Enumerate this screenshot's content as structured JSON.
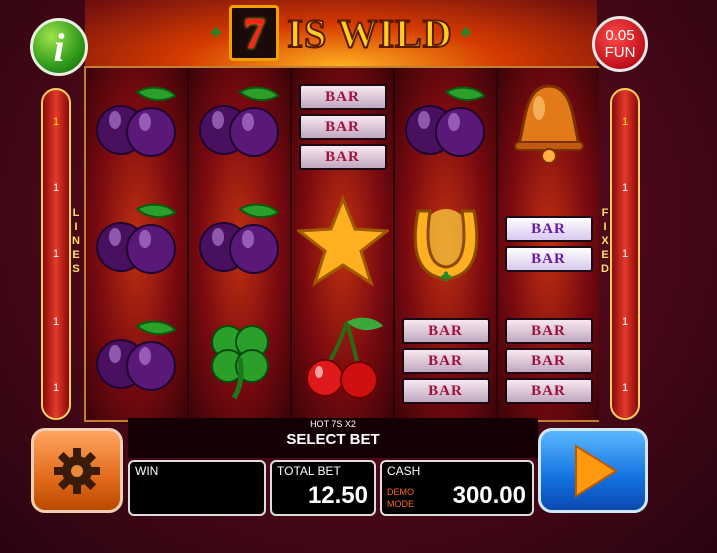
{
  "banner": {
    "seven": "7",
    "title": "IS WILD"
  },
  "info_button": {
    "label": "i"
  },
  "coin_button": {
    "value": "0.05",
    "currency": "FUN"
  },
  "left_rail": {
    "label": "LINES",
    "numbers": [
      "1",
      "1",
      "1",
      "1",
      "1"
    ]
  },
  "right_rail": {
    "label": "FIXED",
    "numbers": [
      "1",
      "1",
      "1",
      "1",
      "1"
    ]
  },
  "reels": [
    [
      "plum",
      "plum",
      "plum"
    ],
    [
      "plum",
      "plum",
      "clover"
    ],
    [
      "bar3",
      "star",
      "cherry"
    ],
    [
      "plum",
      "horseshoe",
      "bar3"
    ],
    [
      "bell",
      "bar2",
      "bar3"
    ]
  ],
  "bar_text": "BAR",
  "bet_panel": {
    "hot_label": "HOT 7S X2",
    "select_bet": "SELECT BET"
  },
  "win_box": {
    "label": "WIN",
    "value": ""
  },
  "total_bet_box": {
    "label": "TOTAL BET",
    "value": "12.50"
  },
  "cash_box": {
    "label": "CASH",
    "demo_line1": "DEMO",
    "demo_line2": "MODE",
    "value": "300.00"
  },
  "icons": {
    "settings": "gear-icon",
    "spin": "play-icon"
  },
  "colors": {
    "accent_red": "#c0101a",
    "settings_orange": "#e26a1a",
    "spin_blue": "#1270e0",
    "info_green": "#2f9a1a"
  }
}
